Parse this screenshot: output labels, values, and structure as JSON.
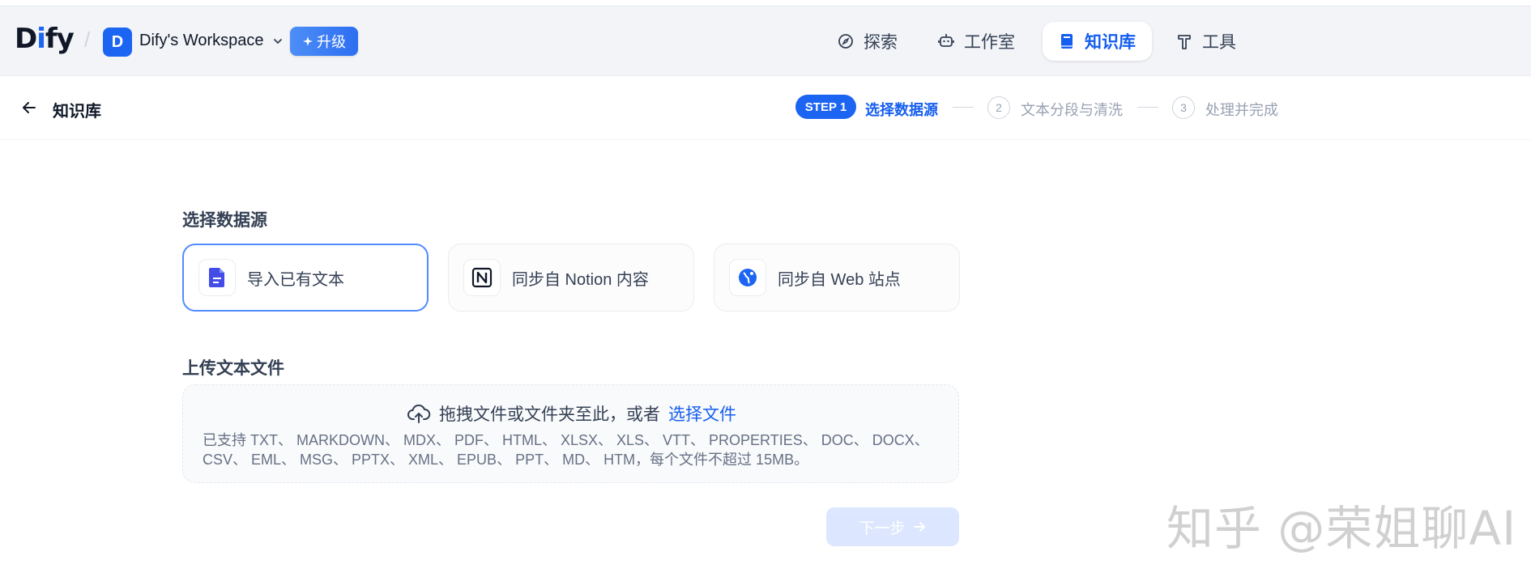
{
  "header": {
    "logo": {
      "pre": "D",
      "accent": "i",
      "post": "fy"
    },
    "workspace": {
      "avatar": "D",
      "name": "Dify's Workspace"
    },
    "upgrade_label": "升级",
    "nav": [
      {
        "label": "探索",
        "icon": "compass-icon"
      },
      {
        "label": "工作室",
        "icon": "robot-icon"
      },
      {
        "label": "知识库",
        "icon": "book-icon",
        "active": true
      },
      {
        "label": "工具",
        "icon": "hammer-icon"
      }
    ]
  },
  "subbar": {
    "title": "知识库",
    "steps": [
      {
        "badge": "STEP 1",
        "label": "选择数据源"
      },
      {
        "num": "2",
        "label": "文本分段与清洗"
      },
      {
        "num": "3",
        "label": "处理并完成"
      }
    ]
  },
  "main": {
    "datasource_title": "选择数据源",
    "datasources": [
      {
        "label": "导入已有文本",
        "icon": "file-text-icon",
        "selected": true
      },
      {
        "label": "同步自 Notion 内容",
        "icon": "notion-icon",
        "selected": false
      },
      {
        "label": "同步自 Web 站点",
        "icon": "globe-icon",
        "selected": false
      }
    ],
    "upload_title": "上传文本文件",
    "upload": {
      "drag_text": "拖拽文件或文件夹至此，或者",
      "select_link": "选择文件",
      "supported_line1": "已支持 TXT、 MARKDOWN、 MDX、 PDF、 HTML、 XLSX、 XLS、 VTT、 PROPERTIES、 DOC、 DOCX、",
      "supported_line2": "CSV、 EML、 MSG、 PPTX、 XML、 EPUB、 PPT、 MD、 HTM，每个文件不超过 15MB。"
    },
    "next_label": "下一步"
  },
  "watermark": "知乎 @荣姐聊AI",
  "colors": {
    "accent": "#1c64f2",
    "active_text": "#155eef",
    "next_disabled": "#d1e0ff"
  }
}
